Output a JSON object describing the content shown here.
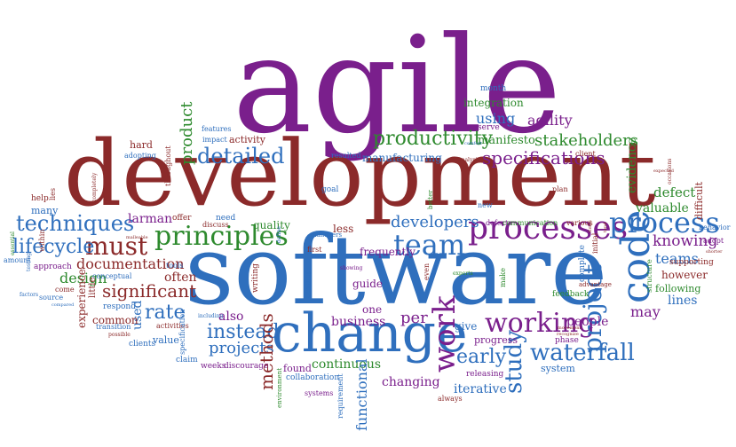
{
  "colors": {
    "purple": "#7a1f8c",
    "red": "#8b2a2a",
    "blue": "#2f6fbd",
    "green": "#2e8a2e",
    "lightblue": "#4a86c8",
    "olive": "#5b7d2b",
    "brown": "#a4542a"
  },
  "words": [
    {
      "text": "agile",
      "color": "purple"
    },
    {
      "text": "development",
      "color": "red"
    },
    {
      "text": "software",
      "color": "blue"
    },
    {
      "text": "change",
      "color": "blue"
    },
    {
      "text": "processes",
      "color": "purple"
    },
    {
      "text": "process",
      "color": "blue"
    },
    {
      "text": "code",
      "color": "blue"
    },
    {
      "text": "work",
      "color": "purple"
    },
    {
      "text": "principles",
      "color": "green"
    },
    {
      "text": "team",
      "color": "blue"
    },
    {
      "text": "working",
      "color": "purple"
    },
    {
      "text": "productivity",
      "color": "green"
    },
    {
      "text": "techniques",
      "color": "blue"
    },
    {
      "text": "must",
      "color": "red"
    },
    {
      "text": "lifecycle",
      "color": "blue"
    },
    {
      "text": "detailed",
      "color": "blue"
    },
    {
      "text": "specifications",
      "color": "purple"
    },
    {
      "text": "stakeholders",
      "color": "green"
    },
    {
      "text": "project",
      "color": "blue"
    },
    {
      "text": "waterfall",
      "color": "blue"
    },
    {
      "text": "study",
      "color": "blue"
    },
    {
      "text": "instead",
      "color": "blue"
    },
    {
      "text": "projects",
      "color": "blue"
    },
    {
      "text": "methods",
      "color": "red"
    },
    {
      "text": "significant",
      "color": "red"
    },
    {
      "text": "rate",
      "color": "blue"
    },
    {
      "text": "early",
      "color": "blue"
    },
    {
      "text": "developers",
      "color": "blue"
    },
    {
      "text": "product",
      "color": "green"
    },
    {
      "text": "design",
      "color": "green"
    },
    {
      "text": "documentation",
      "color": "red"
    },
    {
      "text": "using",
      "color": "blue"
    },
    {
      "text": "agility",
      "color": "purple"
    },
    {
      "text": "manifesto",
      "color": "green"
    },
    {
      "text": "integration",
      "color": "green"
    },
    {
      "text": "evidence",
      "color": "green"
    },
    {
      "text": "defect",
      "color": "green"
    },
    {
      "text": "valuable",
      "color": "green"
    },
    {
      "text": "knowing",
      "color": "purple"
    },
    {
      "text": "teams",
      "color": "blue"
    },
    {
      "text": "however",
      "color": "red"
    },
    {
      "text": "following",
      "color": "green"
    },
    {
      "text": "lines",
      "color": "blue"
    },
    {
      "text": "may",
      "color": "purple"
    },
    {
      "text": "people",
      "color": "purple"
    },
    {
      "text": "business",
      "color": "purple"
    },
    {
      "text": "per",
      "color": "purple"
    },
    {
      "text": "continuous",
      "color": "green"
    },
    {
      "text": "iterative",
      "color": "blue"
    },
    {
      "text": "changing",
      "color": "purple"
    },
    {
      "text": "functional",
      "color": "blue"
    },
    {
      "text": "also",
      "color": "purple"
    },
    {
      "text": "used",
      "color": "blue"
    },
    {
      "text": "often",
      "color": "red"
    },
    {
      "text": "larman",
      "color": "purple"
    },
    {
      "text": "common",
      "color": "red"
    },
    {
      "text": "experience",
      "color": "red"
    },
    {
      "text": "hard",
      "color": "red"
    },
    {
      "text": "activity",
      "color": "red"
    },
    {
      "text": "manufacturing",
      "color": "blue"
    },
    {
      "text": "quality",
      "color": "green"
    },
    {
      "text": "less",
      "color": "red"
    },
    {
      "text": "frequently",
      "color": "purple"
    },
    {
      "text": "guide",
      "color": "purple"
    },
    {
      "text": "one",
      "color": "purple"
    },
    {
      "text": "give",
      "color": "blue"
    },
    {
      "text": "progress",
      "color": "purple"
    },
    {
      "text": "system",
      "color": "blue"
    },
    {
      "text": "found",
      "color": "purple"
    },
    {
      "text": "collaboration",
      "color": "blue"
    },
    {
      "text": "systems",
      "color": "purple"
    },
    {
      "text": "releasing",
      "color": "purple"
    },
    {
      "text": "always",
      "color": "red"
    },
    {
      "text": "difficult",
      "color": "red"
    },
    {
      "text": "many",
      "color": "blue"
    },
    {
      "text": "help",
      "color": "red"
    },
    {
      "text": "approach",
      "color": "purple"
    },
    {
      "text": "amount",
      "color": "blue"
    },
    {
      "text": "come",
      "color": "red"
    },
    {
      "text": "source",
      "color": "blue"
    },
    {
      "text": "within",
      "color": "red"
    },
    {
      "text": "lies",
      "color": "red"
    },
    {
      "text": "respond",
      "color": "blue"
    },
    {
      "text": "transition",
      "color": "blue"
    },
    {
      "text": "conceptual",
      "color": "blue"
    },
    {
      "text": "activities",
      "color": "red"
    },
    {
      "text": "little",
      "color": "red"
    },
    {
      "text": "value",
      "color": "blue"
    },
    {
      "text": "clients",
      "color": "blue"
    },
    {
      "text": "claim",
      "color": "blue"
    },
    {
      "text": "weeks",
      "color": "purple"
    },
    {
      "text": "discourage",
      "color": "purple"
    },
    {
      "text": "tools",
      "color": "blue"
    },
    {
      "text": "offer",
      "color": "red"
    },
    {
      "text": "discuss",
      "color": "red"
    },
    {
      "text": "need",
      "color": "blue"
    },
    {
      "text": "features",
      "color": "blue"
    },
    {
      "text": "impact",
      "color": "blue"
    },
    {
      "text": "adopting",
      "color": "blue"
    },
    {
      "text": "throughout",
      "color": "red"
    },
    {
      "text": "goal",
      "color": "blue"
    },
    {
      "text": "first",
      "color": "red"
    },
    {
      "text": "managers",
      "color": "blue"
    },
    {
      "text": "better",
      "color": "green"
    },
    {
      "text": "serve",
      "color": "purple"
    },
    {
      "text": "resulted",
      "color": "blue"
    },
    {
      "text": "month",
      "color": "blue"
    },
    {
      "text": "new",
      "color": "blue"
    },
    {
      "text": "defects",
      "color": "purple"
    },
    {
      "text": "communication",
      "color": "green"
    },
    {
      "text": "various",
      "color": "red"
    },
    {
      "text": "plan",
      "color": "red"
    },
    {
      "text": "client",
      "color": "red"
    },
    {
      "text": "adopt",
      "color": "purple"
    },
    {
      "text": "behavior",
      "color": "blue"
    },
    {
      "text": "supporting",
      "color": "red"
    },
    {
      "text": "structure",
      "color": "green"
    },
    {
      "text": "feedback",
      "color": "green"
    },
    {
      "text": "complete",
      "color": "blue"
    },
    {
      "text": "initial",
      "color": "red"
    },
    {
      "text": "phase",
      "color": "purple"
    },
    {
      "text": "advantage",
      "color": "red"
    },
    {
      "text": "make",
      "color": "green"
    },
    {
      "text": "experts",
      "color": "green"
    },
    {
      "text": "even",
      "color": "red"
    },
    {
      "text": "showing",
      "color": "purple"
    },
    {
      "text": "specification",
      "color": "blue"
    },
    {
      "text": "including",
      "color": "blue"
    },
    {
      "text": "possible",
      "color": "red"
    },
    {
      "text": "writing",
      "color": "red"
    },
    {
      "text": "develop",
      "color": "blue"
    },
    {
      "text": "environment",
      "color": "green"
    },
    {
      "text": "requirement",
      "color": "blue"
    },
    {
      "text": "completely",
      "color": "red"
    },
    {
      "text": "define",
      "color": "blue"
    },
    {
      "text": "testing",
      "color": "blue"
    },
    {
      "text": "factors",
      "color": "blue"
    },
    {
      "text": "compared",
      "color": "blue"
    },
    {
      "text": "essential",
      "color": "green"
    },
    {
      "text": "malleable",
      "color": "red"
    },
    {
      "text": "analysis",
      "color": "red"
    },
    {
      "text": "comfort",
      "color": "blue"
    },
    {
      "text": "expected",
      "color": "red"
    },
    {
      "text": "occasions",
      "color": "red"
    },
    {
      "text": "times",
      "color": "red"
    },
    {
      "text": "tend",
      "color": "red"
    },
    {
      "text": "movement",
      "color": "red"
    },
    {
      "text": "recognize",
      "color": "red"
    },
    {
      "text": "shorter",
      "color": "red"
    }
  ]
}
